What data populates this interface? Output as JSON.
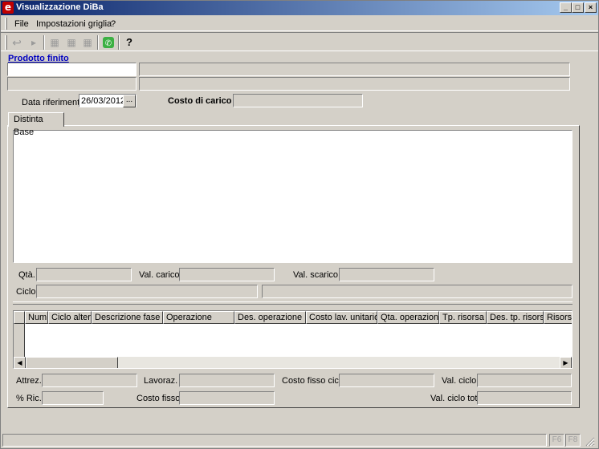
{
  "window": {
    "title": "Visualizzazione DiBa",
    "icon_letter": "e",
    "buttons": {
      "minimize": "_",
      "maximize": "□",
      "close": "×"
    }
  },
  "menu": {
    "items": [
      {
        "label": "File"
      },
      {
        "label": "Impostazioni griglia"
      },
      {
        "label": "?"
      }
    ]
  },
  "toolbar": {
    "icons": [
      "undo-icon",
      "forward-icon",
      "grid-add-icon",
      "grid-icon",
      "grid-delete-icon",
      "phone-icon",
      "help-icon"
    ],
    "glyphs": {
      "undo": "↩",
      "forward": "▸",
      "grid_add": "▦",
      "grid": "▦",
      "grid_delete": "▦",
      "phone": "✆",
      "help": "?"
    }
  },
  "header": {
    "section_title": "Prodotto finito",
    "data_riferimento_label": "Data riferimento",
    "data_riferimento_value": "26/03/2012",
    "date_picker_label": "...",
    "costo_carico_label": "Costo di carico"
  },
  "tabs": [
    {
      "label": "Distinta Base"
    }
  ],
  "details": {
    "qta_label": "Qtà.",
    "val_carico_label": "Val. carico",
    "val_scarico_label": "Val. scarico",
    "ciclo_label": "Ciclo"
  },
  "grid": {
    "columns": [
      "Num.",
      "Ciclo altern.",
      "Descrizione fase",
      "Operazione",
      "Des. operazione",
      "Costo lav. unitario",
      "Qta. operazione",
      "Tp. risorsa",
      "Des. tp. risorsa",
      "Risorsa"
    ],
    "scroll_left": "◀",
    "scroll_right": "▶"
  },
  "footer": {
    "attrez_label": "Attrez.",
    "lavoraz_label": "Lavoraz.",
    "costo_fisso_ciclo_label": "Costo fisso ciclo",
    "val_ciclo_label": "Val. ciclo",
    "ric_label": "% Ric.",
    "costo_fisso_label": "Costo fisso",
    "val_ciclo_tot_label": "Val. ciclo tot."
  },
  "statusbar": {
    "panels": [
      "F6",
      "F8"
    ]
  },
  "colors": {
    "titlebar_start": "#0a246a",
    "titlebar_end": "#a6caf0",
    "section_title": "#0000c0",
    "background": "#d4d0c8"
  }
}
